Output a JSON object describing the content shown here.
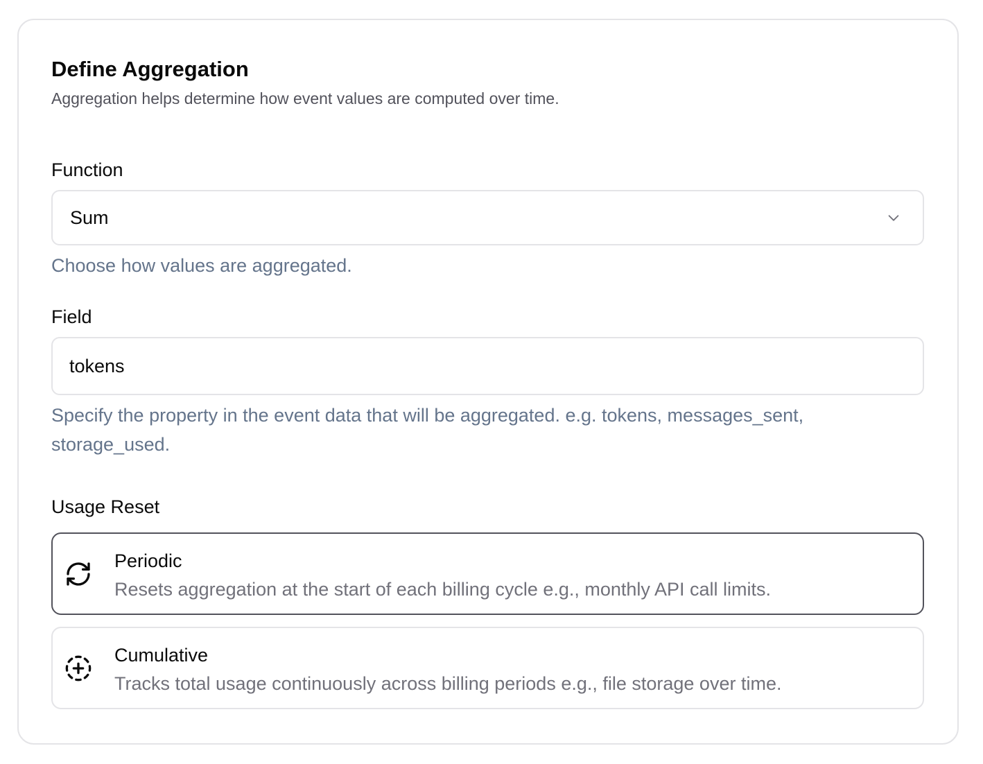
{
  "header": {
    "title": "Define Aggregation",
    "subtitle": "Aggregation helps determine how event values are computed over time."
  },
  "function": {
    "label": "Function",
    "value": "Sum",
    "hint": "Choose how values are aggregated.",
    "icon": "chevron-down-icon"
  },
  "field": {
    "label": "Field",
    "value": "tokens",
    "hint": "Specify the property in the event data that will be aggregated. e.g. tokens, messages_sent, storage_used."
  },
  "usage_reset": {
    "label": "Usage Reset",
    "selected": "periodic",
    "options": [
      {
        "id": "periodic",
        "title": "Periodic",
        "description": "Resets aggregation at the start of each billing cycle e.g., monthly API call limits.",
        "icon": "refresh-cw-icon"
      },
      {
        "id": "cumulative",
        "title": "Cumulative",
        "description": "Tracks total usage continuously across billing periods e.g., file storage over time.",
        "icon": "circle-dashed-plus-icon"
      }
    ]
  },
  "colors": {
    "border": "#e4e4e7",
    "selected_border": "#52525b",
    "hint_text": "#64748b",
    "muted_text": "#52525b"
  }
}
